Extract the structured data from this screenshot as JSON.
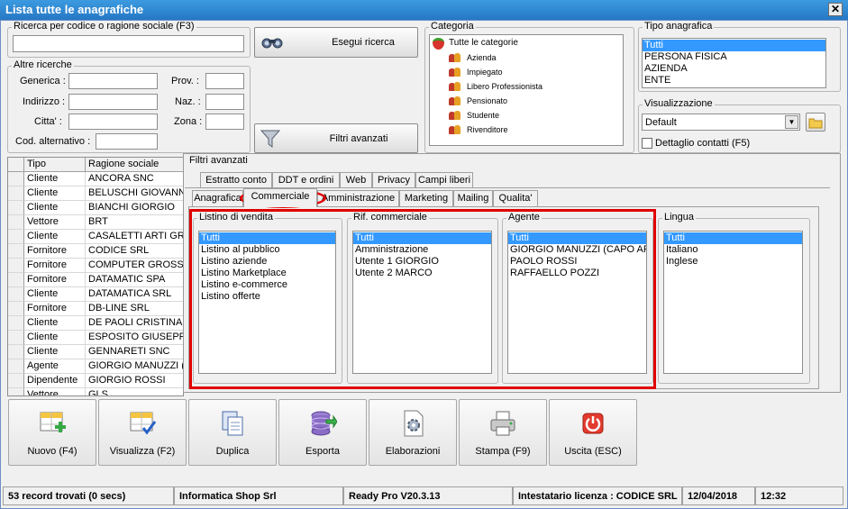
{
  "window": {
    "title": "Lista tutte le anagrafiche",
    "close": "✕"
  },
  "search": {
    "label": "Ricerca per codice o ragione sociale (F3)",
    "value": "",
    "button": "Esegui ricerca"
  },
  "altre": {
    "label": "Altre ricerche",
    "generica": "Generica :",
    "indirizzo": "Indirizzo :",
    "citta": "Citta' :",
    "cod_alt": "Cod. alternativo :",
    "prov": "Prov. :",
    "naz": "Naz. :",
    "zona": "Zona :"
  },
  "filtri_button": "Filtri avanzati",
  "categoria": {
    "label": "Categoria",
    "root": "Tutte le categorie",
    "items": [
      "Azienda",
      "Impiegato",
      "Libero Professionista",
      "Pensionato",
      "Studente",
      "Rivenditore"
    ]
  },
  "tipo": {
    "label": "Tipo anagrafica",
    "items": [
      "Tutti",
      "PERSONA FISICA",
      "AZIENDA",
      "ENTE"
    ],
    "selected": 0
  },
  "visualizzazione": {
    "label": "Visualizzazione",
    "value": "Default",
    "dettaglio": "Dettaglio contatti (F5)"
  },
  "grid": {
    "headers": [
      "Tipo",
      "Ragione sociale"
    ],
    "rows": [
      [
        "Cliente",
        "ANCORA SNC"
      ],
      [
        "Cliente",
        "BELUSCHI GIOVANNI"
      ],
      [
        "Cliente",
        "BIANCHI GIORGIO"
      ],
      [
        "Vettore",
        "BRT"
      ],
      [
        "Cliente",
        "CASALETTI ARTI GRA"
      ],
      [
        "Fornitore",
        "CODICE SRL"
      ],
      [
        "Fornitore",
        "COMPUTER GROSS SP"
      ],
      [
        "Fornitore",
        "DATAMATIC SPA"
      ],
      [
        "Cliente",
        "DATAMATICA SRL"
      ],
      [
        "Fornitore",
        "DB-LINE SRL"
      ],
      [
        "Cliente",
        "DE PAOLI CRISTINA"
      ],
      [
        "Cliente",
        "ESPOSITO GIUSEPPE"
      ],
      [
        "Cliente",
        "GENNARETI SNC"
      ],
      [
        "Agente",
        "GIORGIO MANUZZI (C"
      ],
      [
        "Dipendente",
        "GIORGIO ROSSI"
      ],
      [
        "Vettore",
        "GLS"
      ]
    ]
  },
  "filtri": {
    "title": "Filtri avanzati",
    "tabs_row1": [
      "Estratto conto",
      "DDT e ordini",
      "Web",
      "Privacy",
      "Campi liberi"
    ],
    "tabs_row2": [
      "Anagrafica",
      "Commerciale",
      "Amministrazione",
      "Marketing",
      "Mailing",
      "Qualita'"
    ],
    "listino": {
      "label": "Listino di vendita",
      "items": [
        "Tutti",
        "Listino al pubblico",
        "Listino aziende",
        "Listino Marketplace",
        "Listino e-commerce",
        "Listino offerte"
      ]
    },
    "rif": {
      "label": "Rif. commerciale",
      "items": [
        "Tutti",
        "Amministrazione",
        "Utente 1 GIORGIO",
        "Utente 2 MARCO"
      ]
    },
    "agente": {
      "label": "Agente",
      "items": [
        "Tutti",
        "GIORGIO MANUZZI (CAPO AREA",
        "PAOLO ROSSI",
        "RAFFAELLO POZZI"
      ]
    },
    "lingua": {
      "label": "Lingua",
      "items": [
        "Tutti",
        "Italiano",
        "Inglese"
      ]
    }
  },
  "toolbar": {
    "nuovo": "Nuovo (F4)",
    "visualizza": "Visualizza (F2)",
    "duplica": "Duplica",
    "esporta": "Esporta",
    "elaborazioni": "Elaborazioni",
    "stampa": "Stampa (F9)",
    "uscita": "Uscita (ESC)"
  },
  "status": {
    "records": "53 record trovati (0 secs)",
    "company": "Informatica Shop Srl",
    "version": "Ready Pro V20.3.13",
    "license": "Intestatario licenza : CODICE SRL",
    "date": "12/04/2018",
    "time": "12:32"
  },
  "colors": {
    "highlight": "#e00000",
    "selection": "#3399ff",
    "title": "#2b80cc"
  }
}
